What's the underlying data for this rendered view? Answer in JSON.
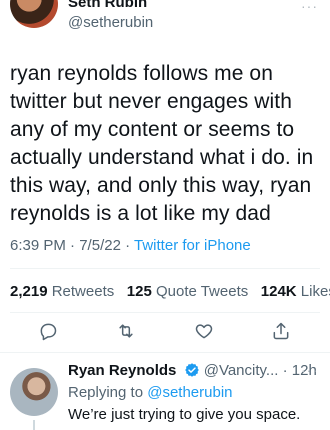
{
  "author": {
    "name": "Seth Rubin",
    "handle": "@setherubin",
    "more": "···"
  },
  "tweet": {
    "text": "ryan reynolds follows me on twitter but never engages with any of my content or seems to actually understand what i do. in this way, and only this way, ryan reynolds is a lot like my dad",
    "time": "6:39 PM",
    "date": "7/5/22",
    "separator": "·",
    "source": "Twitter for iPhone"
  },
  "stats": {
    "retweets_count": "2,219",
    "retweets_label": "Retweets",
    "quotes_count": "125",
    "quotes_label": "Quote Tweets",
    "likes_count": "124K",
    "likes_label": "Likes"
  },
  "actions": [
    "reply-icon",
    "retweet-icon",
    "like-icon",
    "share-icon"
  ],
  "reply": {
    "name": "Ryan Reynolds",
    "handle": "@Vancity...",
    "time": "12h",
    "more": "···",
    "replying_prefix": "Replying to",
    "replying_handle": "@setherubin",
    "text": "We’re just trying to give you space."
  },
  "colors": {
    "accent": "#1d9bf0",
    "muted": "#536471",
    "text": "#0f1419",
    "icon": "#536471"
  }
}
